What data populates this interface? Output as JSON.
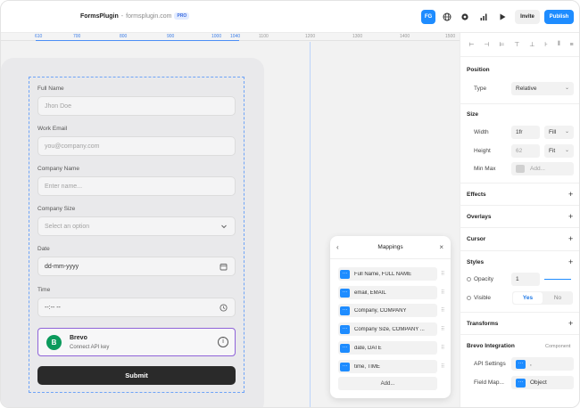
{
  "topbar": {
    "brand": "FormsPlugin",
    "separator": "-",
    "domain": "formsplugin.com",
    "badge": "PRO",
    "avatar_initials": "FG",
    "invite_label": "Invite",
    "publish_label": "Publish",
    "icons": [
      "globe-icon",
      "settings-icon",
      "analytics-icon",
      "play-icon"
    ]
  },
  "ruler": {
    "ticks": [
      "610",
      "700",
      "800",
      "900",
      "1000",
      "1040",
      "1100",
      "1200",
      "1300",
      "1400",
      "1500"
    ]
  },
  "form": {
    "full_name_label": "Full Name",
    "full_name_placeholder": "Jhon Doe",
    "email_label": "Work Email",
    "email_placeholder": "you@company.com",
    "company_label": "Company Name",
    "company_placeholder": "Enter name...",
    "size_label": "Company Size",
    "size_placeholder": "Select an option",
    "date_label": "Date",
    "date_value": "dd-mm-yyyy",
    "time_label": "Time",
    "time_value": "--:-- --",
    "integration_title": "Brevo",
    "integration_sub": "Connect API key",
    "integration_logo": "B",
    "submit_label": "Submit"
  },
  "mappings": {
    "title": "Mappings",
    "rows": [
      "Full Name, FULL NAME",
      "email, EMAIL",
      "Company, COMPANY",
      "Company Size, COMPANY ...",
      "date, DATE",
      "time, TIME"
    ],
    "add_label": "Add..."
  },
  "panel": {
    "position_title": "Position",
    "type_label": "Type",
    "type_value": "Relative",
    "size_title": "Size",
    "width_label": "Width",
    "width_value": "1fr",
    "width_mode": "Fill",
    "height_label": "Height",
    "height_value": "62",
    "height_mode": "Fit",
    "minmax_label": "Min Max",
    "minmax_value": "Add...",
    "effects_title": "Effects",
    "overlays_title": "Overlays",
    "cursor_title": "Cursor",
    "styles_title": "Styles",
    "opacity_label": "Opacity",
    "opacity_value": "1",
    "visible_label": "Visible",
    "visible_yes": "Yes",
    "visible_no": "No",
    "transforms_title": "Transforms",
    "brevo_title": "Brevo Integration",
    "brevo_note": "Component",
    "api_label": "API Settings",
    "api_value": ",",
    "fieldmap_label": "Field Map...",
    "fieldmap_value": "Object"
  },
  "colors": {
    "accent": "#1e8cff",
    "selection": "#6ea4f7",
    "integration_border": "#8f63d9",
    "brevo_green": "#0b9a5c"
  }
}
